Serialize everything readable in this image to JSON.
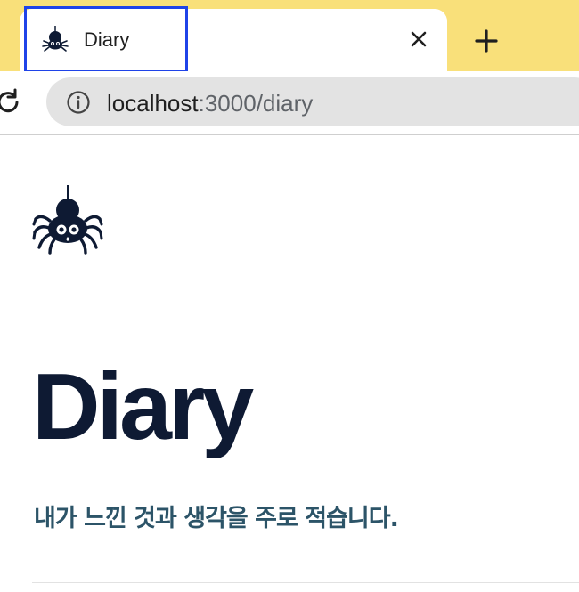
{
  "browser": {
    "tab": {
      "title": "Diary",
      "favicon": "spider-icon",
      "close_icon": "close-icon"
    },
    "new_tab_icon": "plus-icon",
    "reload_icon": "reload-icon",
    "site_info_icon": "info-icon",
    "url": {
      "host": "localhost",
      "path": ":3000/diary"
    },
    "colors": {
      "tabstrip": "#f9e07a",
      "focus_ring": "#1f43e8",
      "omnibox": "#e3e3e3"
    }
  },
  "page": {
    "logo": "spider-icon",
    "title": "Diary",
    "subtitle": "내가 느낀 것과 생각을 주로 적습니다.",
    "colors": {
      "title": "#0e1a33",
      "subtitle": "#2c5468"
    }
  }
}
